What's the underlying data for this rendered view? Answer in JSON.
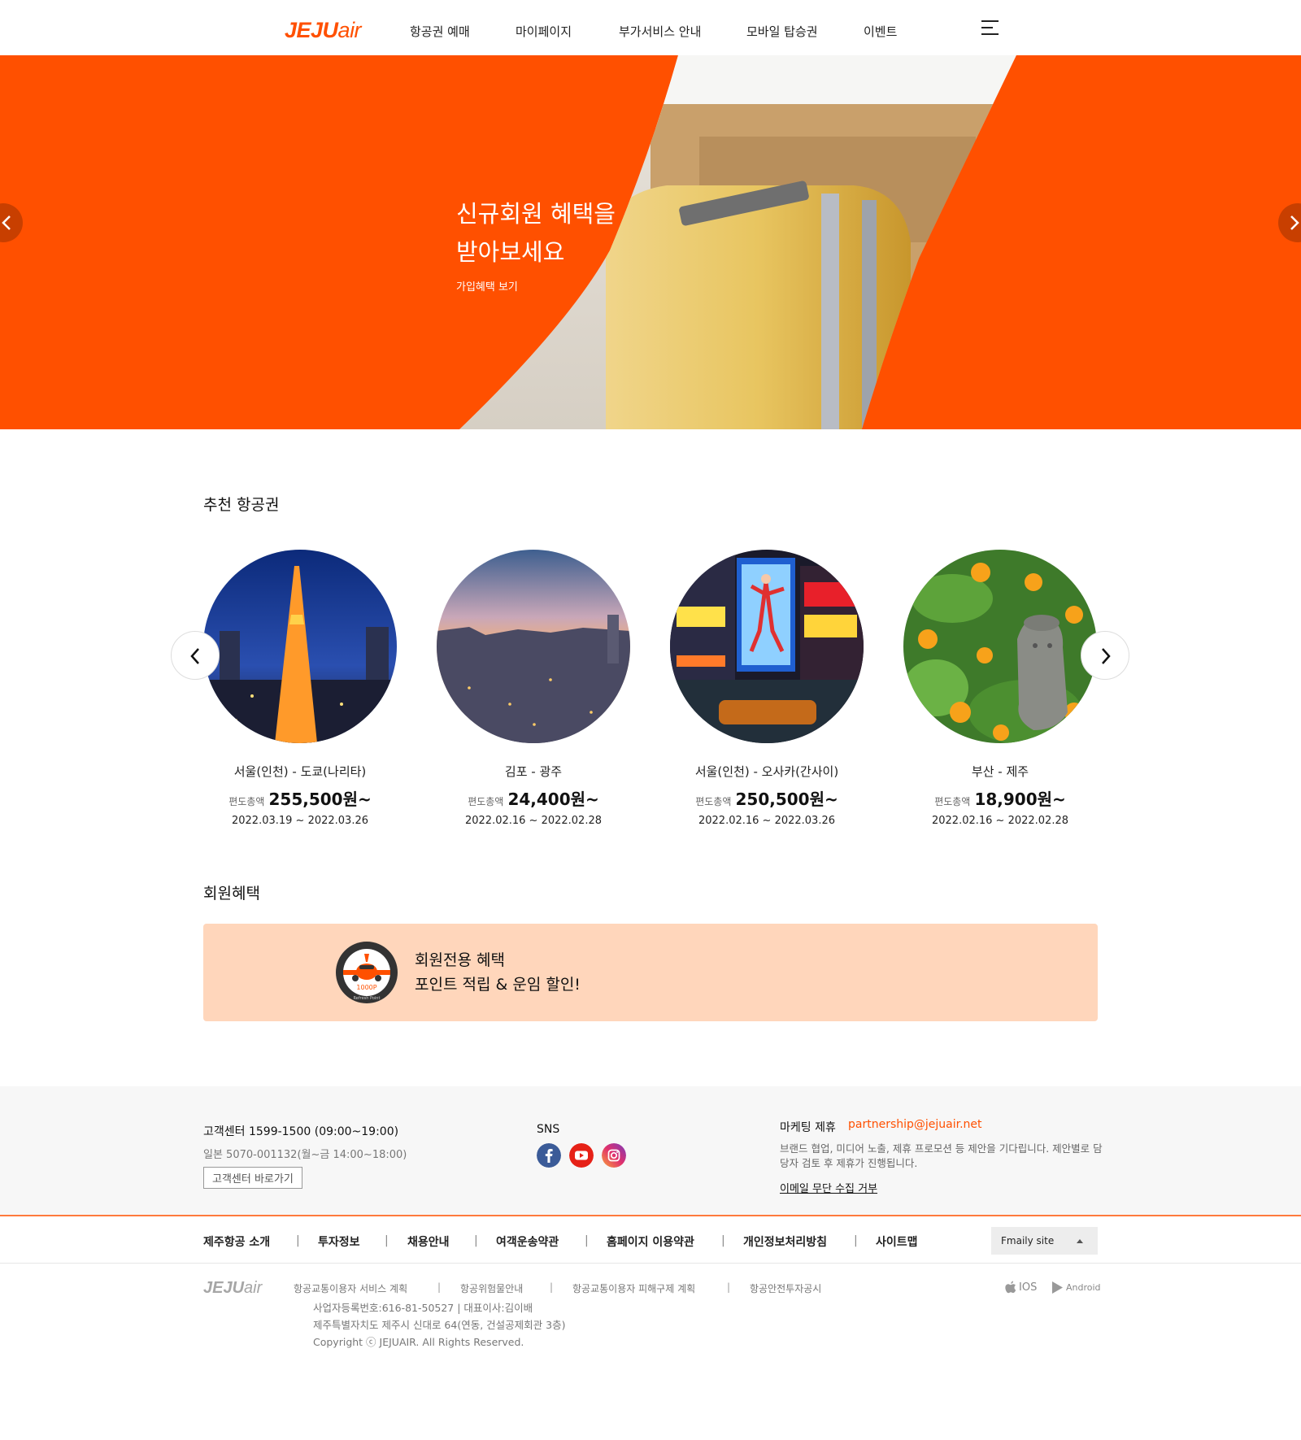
{
  "header": {
    "logo_main": "JEJU",
    "logo_air": "air",
    "nav": [
      "항공권 예매",
      "마이페이지",
      "부가서비스 안내",
      "모바일 탑승권",
      "이벤트"
    ],
    "menu_icon": "hamburger-icon"
  },
  "hero": {
    "title_line1": "신규회원 혜택을",
    "title_line2": "받아보세요",
    "link": "가입혜택 보기",
    "bg_color": "#ff5000"
  },
  "recommend": {
    "title": "추천 항공권",
    "tickets": [
      {
        "route": "서울(인천) - 도쿄(나리타)",
        "price_label": "편도총액",
        "price": "255,500원~",
        "dates": "2022.03.19 ~ 2022.03.26"
      },
      {
        "route": "김포 - 광주",
        "price_label": "편도총액",
        "price": "24,400원~",
        "dates": "2022.02.16 ~ 2022.02.28"
      },
      {
        "route": "서울(인천) - 오사카(간사이)",
        "price_label": "편도총액",
        "price": "250,500원~",
        "dates": "2022.02.16 ~ 2022.03.26"
      },
      {
        "route": "부산 - 제주",
        "price_label": "편도총액",
        "price": "18,900원~",
        "dates": "2022.02.16 ~ 2022.02.28"
      }
    ]
  },
  "benefit": {
    "title": "회원혜택",
    "line1": "회원전용 혜택",
    "line2": "포인트 적립 & 운임 할인!",
    "badge_text": "1000P",
    "badge_ring": "Refresh Point",
    "bg_color": "#ffd6bb"
  },
  "footer": {
    "call_center": "고객센터 1599-1500 (09:00~19:00)",
    "japan": "일본 5070-001132(월~금 14:00~18:00)",
    "cs_button": "고객센터 바로가기",
    "sns_label": "SNS",
    "sns_icons": [
      "facebook-icon",
      "youtube-icon",
      "instagram-icon"
    ],
    "marketing_label": "마케팅 제휴",
    "marketing_email": "partnership@jejuair.net",
    "marketing_desc": "브랜드 협업, 미디어 노출, 제휴 프로모션 등 제안을 기다립니다. 제안별로 담당자 검토 후 제휴가 진행됩니다.",
    "email_refuse": "이메일 무단 수집 거부",
    "links": [
      "제주항공 소개",
      "투자정보",
      "채용안내",
      "여객운송약관",
      "홈페이지 이용약관",
      "개인정보처리방침",
      "사이트맵"
    ],
    "family_site": "Fmaily site",
    "bottom_links": [
      "항공교통이용자 서비스 계획",
      "항공위험물안내",
      "항공교통이용자 피해구제 계획",
      "항공안전투자공시"
    ],
    "biz_info": "사업자등록번호:616-81-50527  |  대표이사:김이배",
    "address": "제주특별자치도 제주시 신대로 64(연동, 건설공제회관 3층)",
    "copyright": "Copyright ⓒ JEJUAIR. All Rights Reserved.",
    "app_ios": "IOS",
    "app_android": "Android",
    "separator": "|"
  }
}
